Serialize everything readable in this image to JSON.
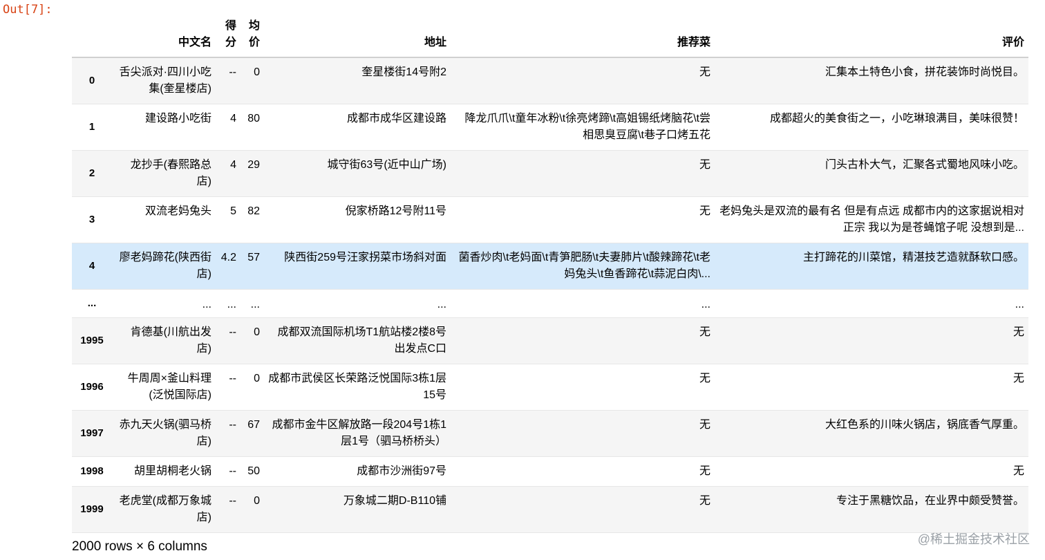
{
  "prompt": "Out[7]:",
  "columns": [
    "中文名",
    "得分",
    "均价",
    "地址",
    "推荐菜",
    "评价"
  ],
  "rows": [
    {
      "index": "0",
      "cells": [
        "舌尖派对·四川小吃集(奎星楼店)",
        "--",
        "0",
        "奎星楼街14号附2",
        "无",
        "汇集本土特色小食，拼花装饰时尚悦目。"
      ]
    },
    {
      "index": "1",
      "cells": [
        "建设路小吃街",
        "4",
        "80",
        "成都市成华区建设路",
        "降龙爪爪\\t童年冰粉\\t徐亮烤蹄\\t高姐锡纸烤脑花\\t尝相思臭豆腐\\t巷子口烤五花",
        "成都超火的美食街之一，小吃琳琅满目，美味很赞！"
      ]
    },
    {
      "index": "2",
      "cells": [
        "龙抄手(春熙路总店)",
        "4",
        "29",
        "城守街63号(近中山广场)",
        "无",
        "门头古朴大气，汇聚各式蜀地风味小吃。"
      ]
    },
    {
      "index": "3",
      "cells": [
        "双流老妈兔头",
        "5",
        "82",
        "倪家桥路12号附11号",
        "无",
        "老妈兔头是双流的最有名 但是有点远 成都市内的这家据说相对正宗 我以为是苍蝇馆子呢 没想到是..."
      ]
    },
    {
      "index": "4",
      "cells": [
        "廖老妈蹄花(陕西街店)",
        "4.2",
        "57",
        "陕西街259号汪家拐菜市场斜对面",
        "菌香炒肉\\t老妈面\\t青笋肥肠\\t夫妻肺片\\t酸辣蹄花\\t老妈兔头\\t鱼香蹄花\\t蒜泥白肉\\...",
        "主打蹄花的川菜馆，精湛技艺造就酥软口感。"
      ]
    },
    {
      "index": "...",
      "cells": [
        "...",
        "...",
        "...",
        "...",
        "...",
        "..."
      ]
    },
    {
      "index": "1995",
      "cells": [
        "肯德基(川航出发店)",
        "--",
        "0",
        "成都双流国际机场T1航站楼2楼8号出发点C口",
        "无",
        "无"
      ]
    },
    {
      "index": "1996",
      "cells": [
        "牛周周×釜山料理(泛悦国际店)",
        "--",
        "0",
        "成都市武侯区长荣路泛悦国际3栋1层15号",
        "无",
        "无"
      ]
    },
    {
      "index": "1997",
      "cells": [
        "赤九天火锅(驷马桥店)",
        "--",
        "67",
        "成都市金牛区解放路一段204号1栋1层1号（驷马桥桥头）",
        "无",
        "大红色系的川味火锅店，锅底香气厚重。"
      ]
    },
    {
      "index": "1998",
      "cells": [
        "胡里胡桐老火锅",
        "--",
        "50",
        "成都市沙洲街97号",
        "无",
        "无"
      ]
    },
    {
      "index": "1999",
      "cells": [
        "老虎堂(成都万象城店)",
        "--",
        "0",
        "万象城二期D-B110铺",
        "无",
        "专注于黑糖饮品，在业界中颇受赞誉。"
      ]
    }
  ],
  "shape_text": "2000 rows × 6 columns",
  "watermark": "@稀土掘金技术社区",
  "colors": {
    "prompt": "#d84315",
    "row_stripe": "#f5f5f5",
    "row_hover": "#d6eafb"
  }
}
